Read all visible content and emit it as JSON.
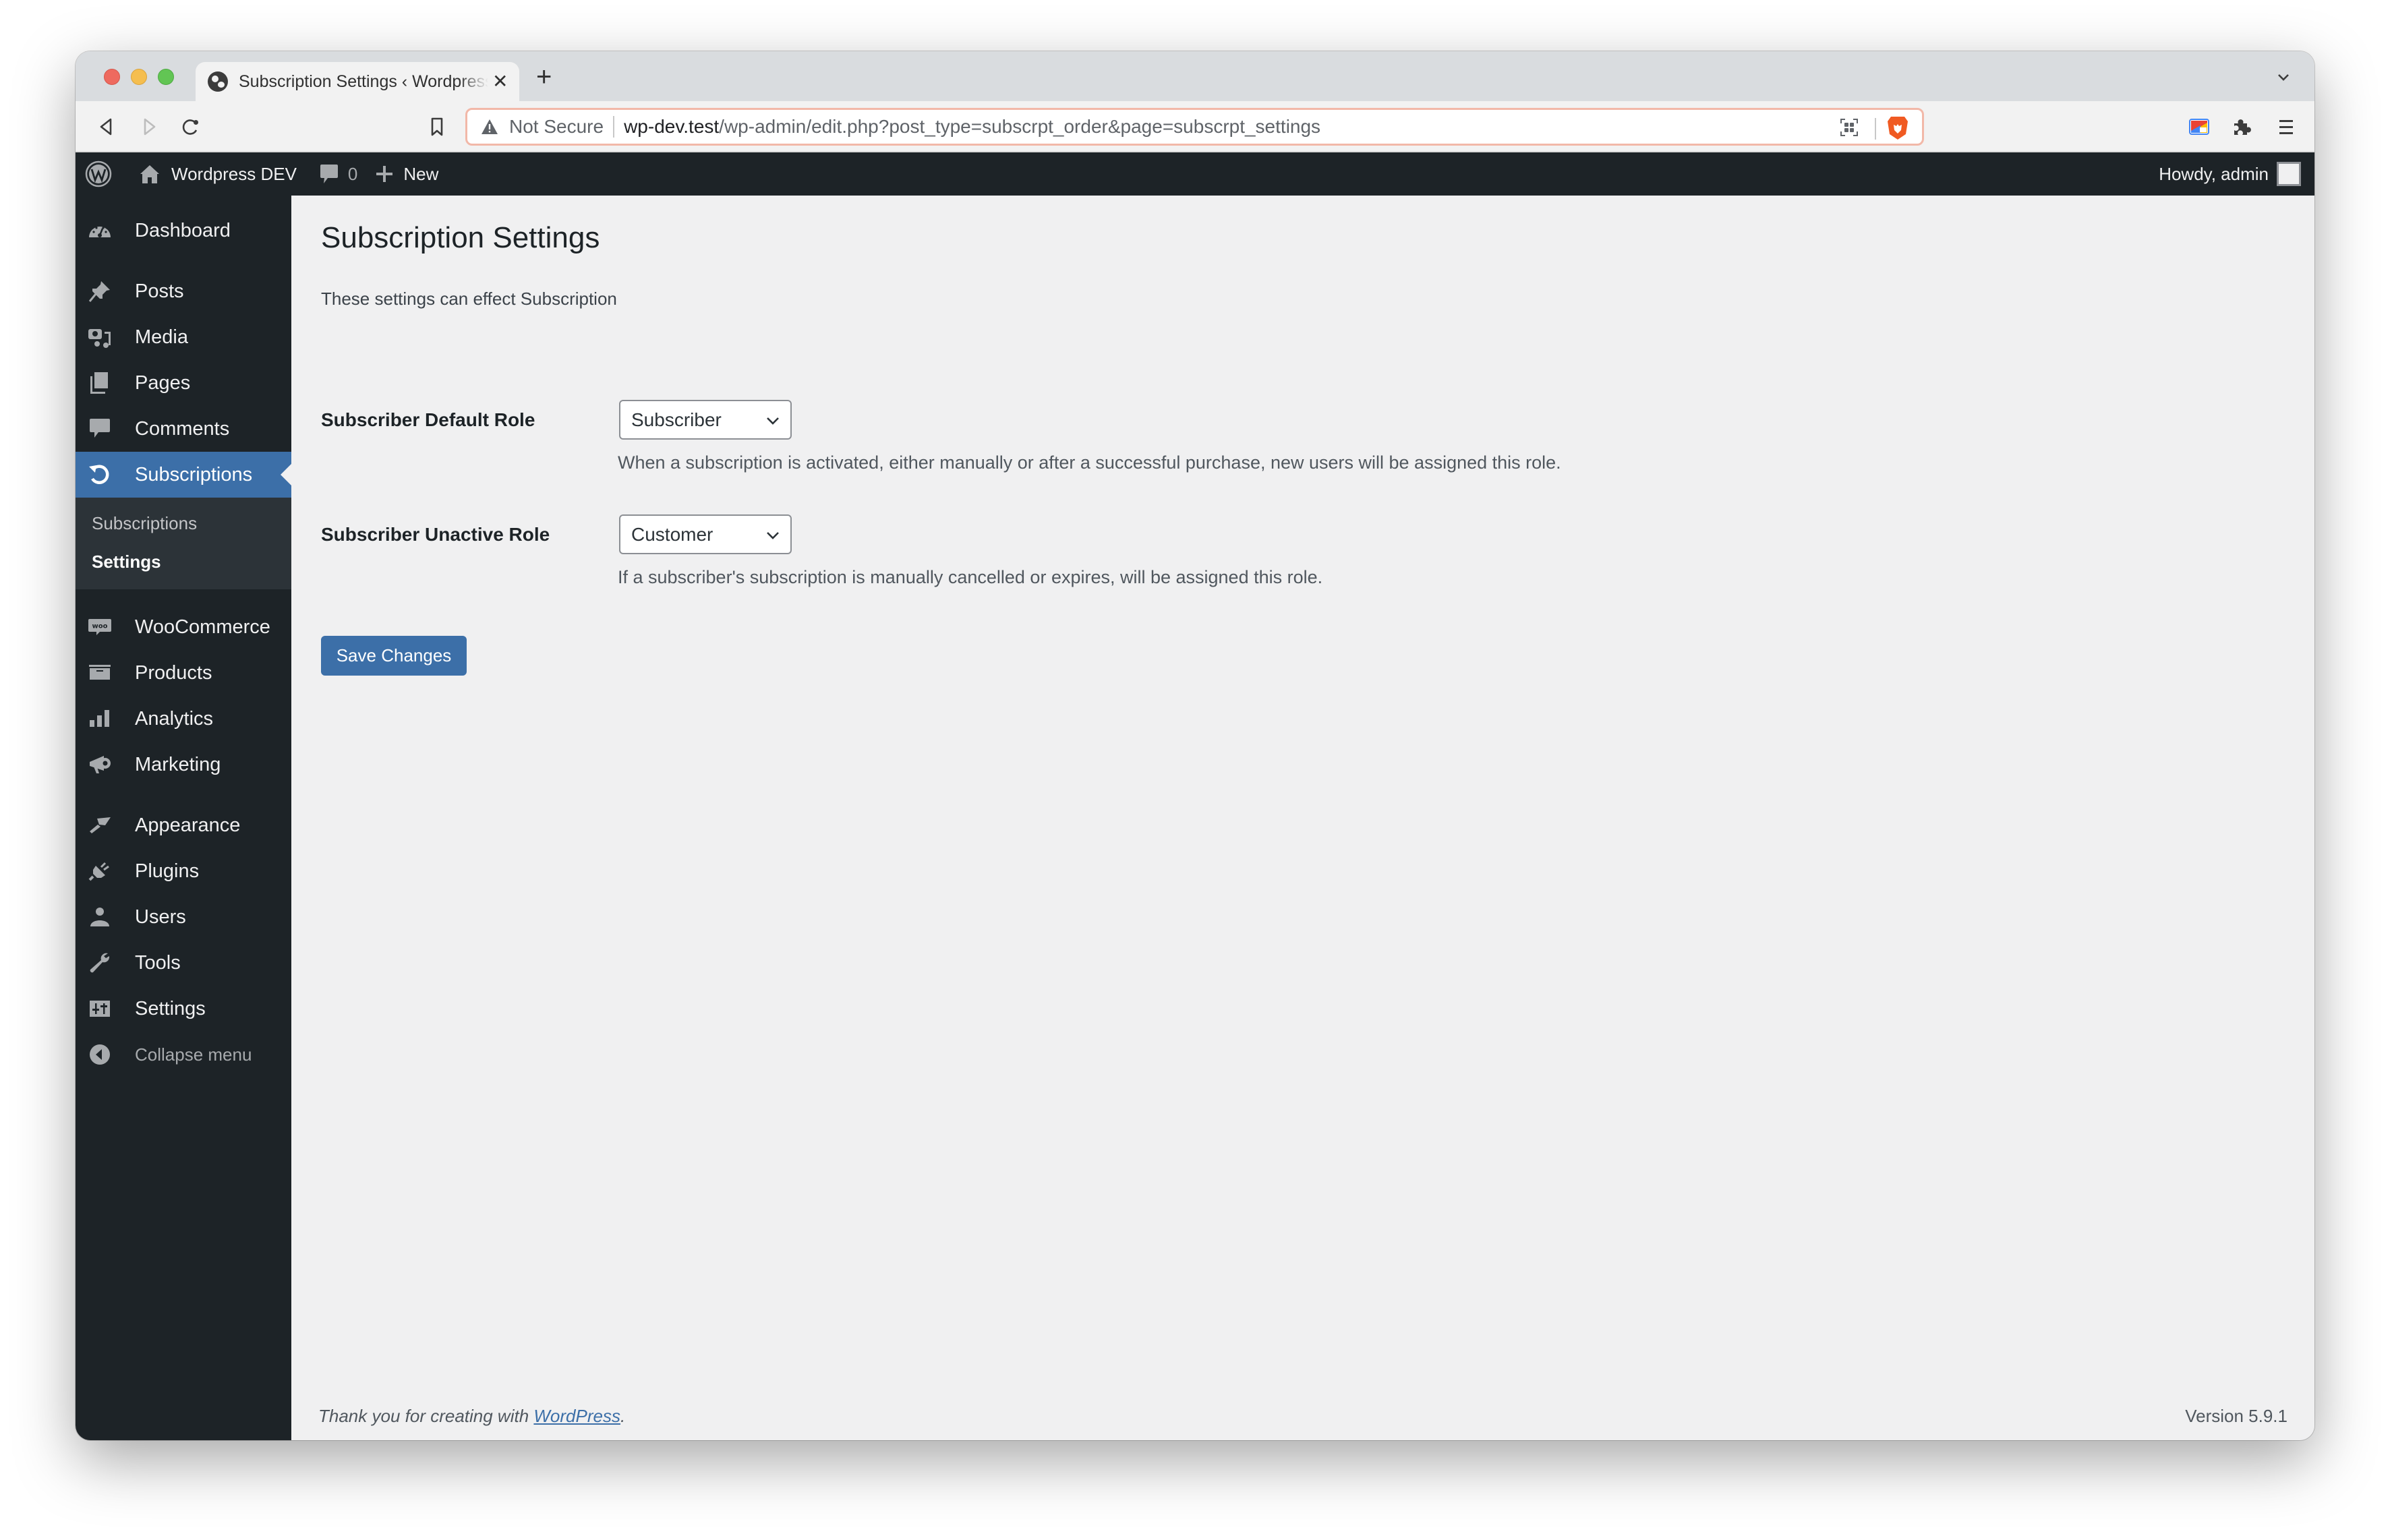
{
  "browser": {
    "tab_title": "Subscription Settings ‹ Wordpress DEV",
    "tab_close": "✕",
    "new_tab": "+",
    "security_label": "Not Secure",
    "url_host": "wp-dev.test",
    "url_path": "/wp-admin/edit.php?post_type=subscrpt_order&page=subscrpt_settings"
  },
  "adminbar": {
    "site_name": "Wordpress DEV",
    "comments_count": "0",
    "new_label": "New",
    "howdy": "Howdy, admin"
  },
  "sidebar": {
    "items": [
      {
        "label": "Dashboard",
        "icon": "dashboard-icon"
      },
      {
        "label": "Posts",
        "icon": "pin-icon"
      },
      {
        "label": "Media",
        "icon": "media-icon"
      },
      {
        "label": "Pages",
        "icon": "pages-icon"
      },
      {
        "label": "Comments",
        "icon": "comment-icon"
      },
      {
        "label": "Subscriptions",
        "icon": "refresh-icon",
        "active": true
      },
      {
        "label": "WooCommerce",
        "icon": "woo-icon"
      },
      {
        "label": "Products",
        "icon": "archive-icon"
      },
      {
        "label": "Analytics",
        "icon": "bar-chart-icon"
      },
      {
        "label": "Marketing",
        "icon": "megaphone-icon"
      },
      {
        "label": "Appearance",
        "icon": "paintbrush-icon"
      },
      {
        "label": "Plugins",
        "icon": "plug-icon"
      },
      {
        "label": "Users",
        "icon": "user-icon"
      },
      {
        "label": "Tools",
        "icon": "wrench-icon"
      },
      {
        "label": "Settings",
        "icon": "sliders-icon"
      }
    ],
    "submenu": [
      {
        "label": "Subscriptions"
      },
      {
        "label": "Settings",
        "current": true
      }
    ],
    "collapse_label": "Collapse menu"
  },
  "main": {
    "title": "Subscription Settings",
    "description": "These settings can effect Subscription",
    "fields": [
      {
        "label": "Subscriber Default Role",
        "value": "Subscriber",
        "help": "When a subscription is activated, either manually or after a successful purchase, new users will be assigned this role."
      },
      {
        "label": "Subscriber Unactive Role",
        "value": "Customer",
        "help": "If a subscriber's subscription is manually cancelled or expires, will be assigned this role."
      }
    ],
    "save_label": "Save Changes"
  },
  "footer": {
    "thanks_prefix": "Thank you for creating with ",
    "thanks_link": "WordPress",
    "thanks_suffix": ".",
    "version": "Version 5.9.1"
  },
  "colors": {
    "accent": "#3c6fa8",
    "adminbar_bg": "#1d2327",
    "submenu_bg": "#2c3338",
    "content_bg": "#f0f0f1",
    "brave_orange": "#f05a22"
  }
}
